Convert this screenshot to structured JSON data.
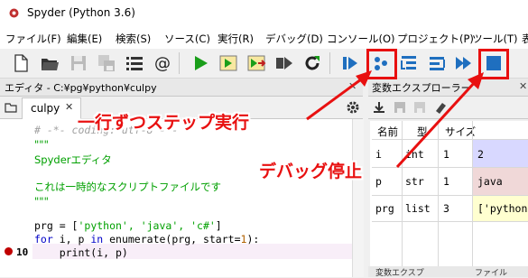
{
  "window": {
    "title": "Spyder (Python 3.6)"
  },
  "menu": [
    "ファイル(F)",
    "編集(E)",
    "検索(S)",
    "ソース(C)",
    "実行(R)",
    "デバッグ(D)",
    "コンソール(O)",
    "プロジェクト(P)",
    "ツール(T)",
    "表"
  ],
  "toolbar": {
    "icons": [
      "new-file-icon",
      "open-folder-icon",
      "save-icon",
      "save-all-icon",
      "list-icon",
      "at-sign-icon",
      "run-icon",
      "run-cell-icon",
      "run-cell-advance-icon",
      "run-selection-icon",
      "rerun-icon",
      "debug-icon",
      "step-icon",
      "step-into-icon",
      "step-return-icon",
      "continue-icon",
      "stop-debug-icon"
    ],
    "accent_green": "#1a9e1a",
    "accent_blue": "#1f6fbf"
  },
  "editor": {
    "title": "エディタ - C:¥pg¥python¥culpy",
    "tab_label": "culpy",
    "lines": {
      "l1": "# -*- coding: utf-8 -*-",
      "l2": "\"\"\"",
      "l3": "Spyderエディタ",
      "l4": "これは一時的なスクリプトファイルです",
      "l5": "\"\"\"",
      "l6_a": "prg = [",
      "l6_b": "'python', 'java', 'c#'",
      "l6_c": "]",
      "l7_a": "for",
      "l7_b": " i, p ",
      "l7_c": "in",
      "l7_d": " enumerate(prg, start=",
      "l7_e": "1",
      "l7_f": "):",
      "l8": "    print(i, p)"
    },
    "current_line_number": "10"
  },
  "variable_explorer": {
    "title": "変数エクスプローラー",
    "headers": [
      "名前",
      "型",
      "サイズ"
    ],
    "rows": [
      {
        "name": "i",
        "type": "int",
        "size": "1",
        "value": "2",
        "color": "#d8d8ff"
      },
      {
        "name": "p",
        "type": "str",
        "size": "1",
        "value": "java",
        "color": "#f0d8d8"
      },
      {
        "name": "prg",
        "type": "list",
        "size": "3",
        "value": "['python",
        "color": "#ffffd0"
      }
    ],
    "bottom_tabs": [
      "変数エクスプ",
      "ファイル"
    ]
  },
  "annotations": {
    "step_label": "一行ずつステップ実行",
    "stop_label": "デバッグ停止",
    "color": "#e81010"
  }
}
